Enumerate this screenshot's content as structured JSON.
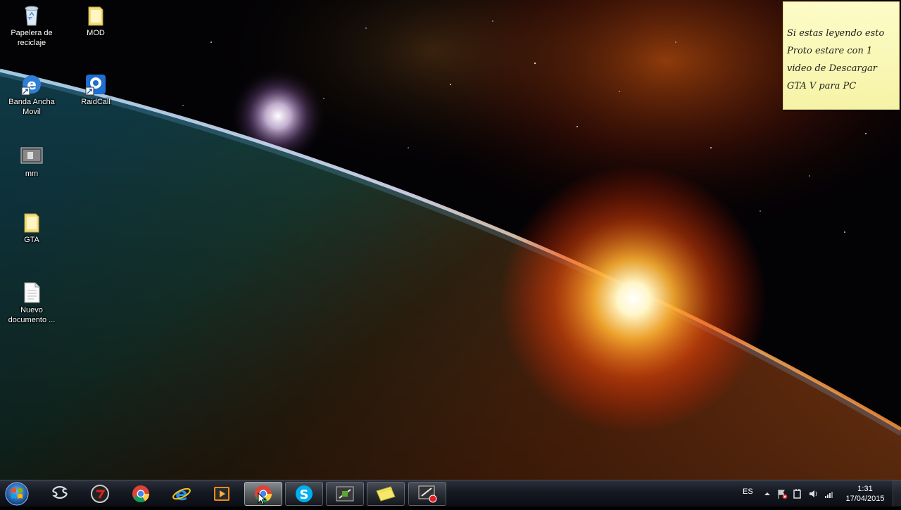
{
  "desktop": {
    "icons": [
      {
        "label": "Papelera de reciclaje",
        "icon": "recycle-bin-icon"
      },
      {
        "label": "MOD",
        "icon": "folder-icon"
      },
      {
        "label": "Banda Ancha Movil",
        "icon": "broadband-shortcut-icon"
      },
      {
        "label": "RaidCall",
        "icon": "raidcall-shortcut-icon"
      },
      {
        "label": "mm",
        "icon": "image-file-icon"
      },
      {
        "label": "GTA",
        "icon": "folder-icon"
      },
      {
        "label": "Nuevo documento ...",
        "icon": "text-document-icon"
      }
    ]
  },
  "sticky_note": {
    "text": "Si estas leyendo esto\nProto estare con 1\nvideo de Descargar\nGTA V para PC"
  },
  "taskbar": {
    "start": "start-button",
    "items": [
      {
        "icon": "sonic-icon",
        "state": "pinned"
      },
      {
        "icon": "speedometer-app-icon",
        "state": "pinned"
      },
      {
        "icon": "chrome-icon",
        "state": "pinned"
      },
      {
        "icon": "internet-explorer-icon",
        "state": "pinned"
      },
      {
        "icon": "media-player-icon",
        "state": "pinned"
      },
      {
        "icon": "chrome-icon",
        "state": "active"
      },
      {
        "icon": "skype-icon",
        "state": "running"
      },
      {
        "icon": "game-app-icon",
        "state": "running"
      },
      {
        "icon": "sticky-notes-icon",
        "state": "running"
      },
      {
        "icon": "screen-recorder-icon",
        "state": "running"
      }
    ],
    "tray": {
      "language": "ES",
      "time": "1:31",
      "date": "17/04/2015"
    }
  },
  "colors": {
    "sticky_bg": "#f8f5b0",
    "taskbar_bg": "#151922",
    "sun": "#ff7a1a"
  }
}
